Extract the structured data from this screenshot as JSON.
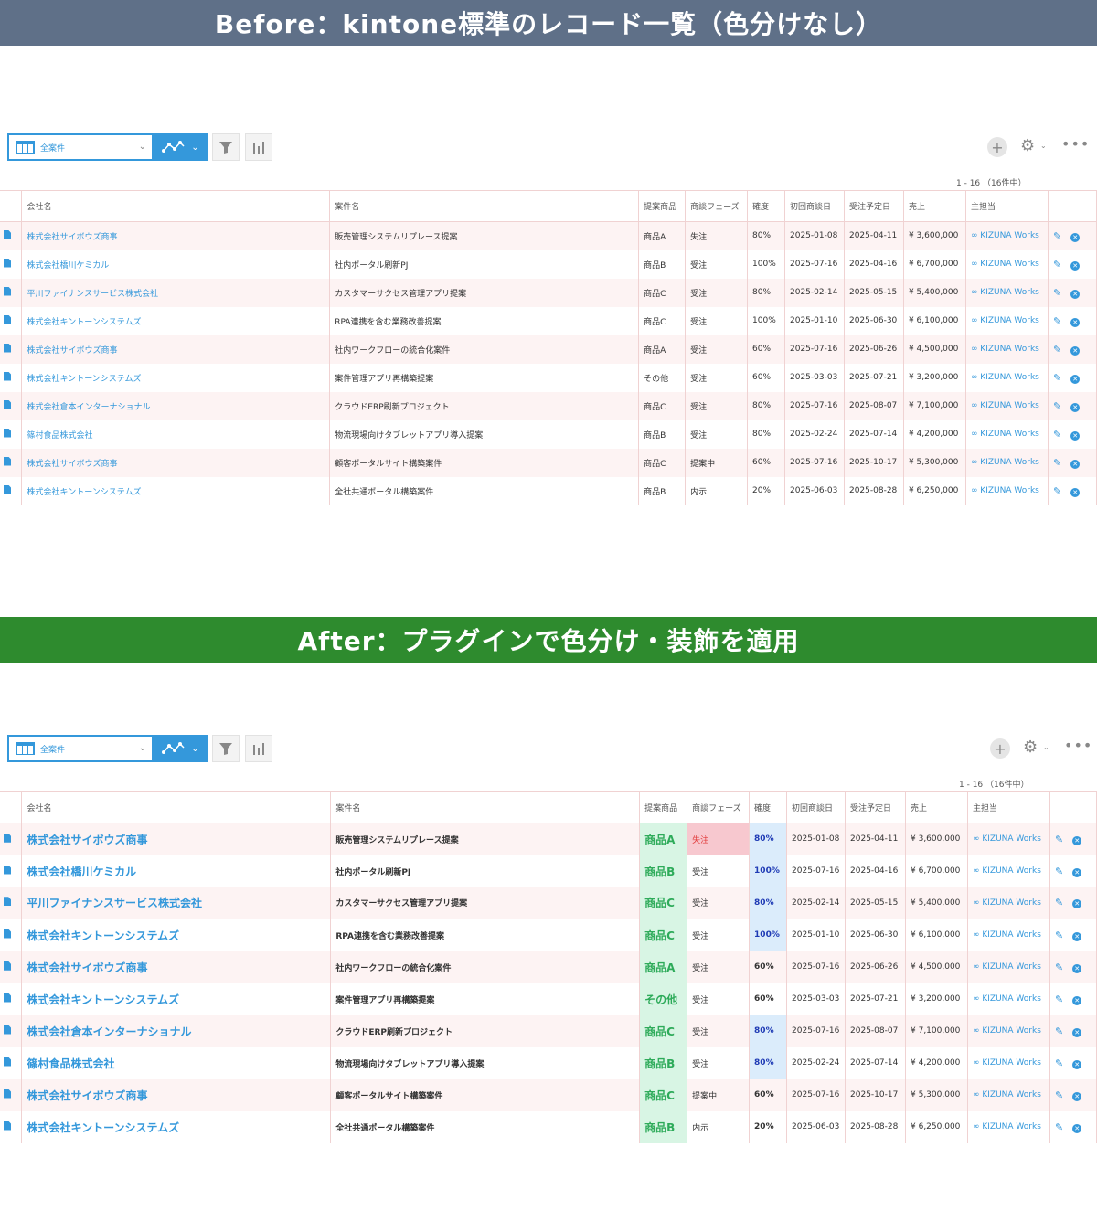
{
  "banners": {
    "before": "Before：kintone標準のレコード一覧（色分けなし）",
    "after": "After：プラグインで色分け・装飾を適用"
  },
  "toolbar": {
    "view_label": "全案件",
    "pager": "1 - 16 （16件中）"
  },
  "columns": [
    "会社名",
    "案件名",
    "提案商品",
    "商談フェーズ",
    "確度",
    "初回商談日",
    "受注予定日",
    "売上",
    "主担当"
  ],
  "rows": [
    {
      "company": "株式会社サイボウズ商事",
      "deal": "販売管理システムリプレース提案",
      "product": "商品A",
      "phase": "失注",
      "confidence": "80%",
      "first": "2025-01-08",
      "order": "2025-04-11",
      "sales": "¥ 3,600,000",
      "owner": "∞ KIZUNA Works"
    },
    {
      "company": "株式会社橋川ケミカル",
      "deal": "社内ポータル刷新PJ",
      "product": "商品B",
      "phase": "受注",
      "confidence": "100%",
      "first": "2025-07-16",
      "order": "2025-04-16",
      "sales": "¥ 6,700,000",
      "owner": "∞ KIZUNA Works"
    },
    {
      "company": "平川ファイナンスサービス株式会社",
      "deal": "カスタマーサクセス管理アプリ提案",
      "product": "商品C",
      "phase": "受注",
      "confidence": "80%",
      "first": "2025-02-14",
      "order": "2025-05-15",
      "sales": "¥ 5,400,000",
      "owner": "∞ KIZUNA Works"
    },
    {
      "company": "株式会社キントーンシステムズ",
      "deal": "RPA連携を含む業務改善提案",
      "product": "商品C",
      "phase": "受注",
      "confidence": "100%",
      "first": "2025-01-10",
      "order": "2025-06-30",
      "sales": "¥ 6,100,000",
      "owner": "∞ KIZUNA Works"
    },
    {
      "company": "株式会社サイボウズ商事",
      "deal": "社内ワークフローの統合化案件",
      "product": "商品A",
      "phase": "受注",
      "confidence": "60%",
      "first": "2025-07-16",
      "order": "2025-06-26",
      "sales": "¥ 4,500,000",
      "owner": "∞ KIZUNA Works"
    },
    {
      "company": "株式会社キントーンシステムズ",
      "deal": "案件管理アプリ再構築提案",
      "product": "その他",
      "phase": "受注",
      "confidence": "60%",
      "first": "2025-03-03",
      "order": "2025-07-21",
      "sales": "¥ 3,200,000",
      "owner": "∞ KIZUNA Works"
    },
    {
      "company": "株式会社倉本インターナショナル",
      "deal": "クラウドERP刷新プロジェクト",
      "product": "商品C",
      "phase": "受注",
      "confidence": "80%",
      "first": "2025-07-16",
      "order": "2025-08-07",
      "sales": "¥ 7,100,000",
      "owner": "∞ KIZUNA Works"
    },
    {
      "company": "篠村食品株式会社",
      "deal": "物流現場向けタブレットアプリ導入提案",
      "product": "商品B",
      "phase": "受注",
      "confidence": "80%",
      "first": "2025-02-24",
      "order": "2025-07-14",
      "sales": "¥ 4,200,000",
      "owner": "∞ KIZUNA Works"
    },
    {
      "company": "株式会社サイボウズ商事",
      "deal": "顧客ポータルサイト構築案件",
      "product": "商品C",
      "phase": "提案中",
      "confidence": "60%",
      "first": "2025-07-16",
      "order": "2025-10-17",
      "sales": "¥ 5,300,000",
      "owner": "∞ KIZUNA Works"
    },
    {
      "company": "株式会社キントーンシステムズ",
      "deal": "全社共通ポータル構築案件",
      "product": "商品B",
      "phase": "内示",
      "confidence": "20%",
      "first": "2025-06-03",
      "order": "2025-08-28",
      "sales": "¥ 6,250,000",
      "owner": "∞ KIZUNA Works"
    }
  ],
  "colors": {
    "banner_before": "#5f7088",
    "banner_after": "#2e8b2e",
    "accent": "#3498db",
    "product_bg": "#d8f5e4",
    "product_text": "#2eab5a",
    "lost_bg": "#f7c8cf",
    "lost_text": "#e23b3b",
    "confidence_bg": "#dbecfb",
    "confidence_text": "#1f3bb5",
    "highlight_border": "#2a5fa8"
  },
  "icons": [
    "table-view-icon",
    "graph-icon",
    "filter-icon",
    "bar-chart-icon",
    "plus-icon",
    "gear-icon",
    "more-icon",
    "document-icon",
    "pencil-icon",
    "close-icon"
  ]
}
